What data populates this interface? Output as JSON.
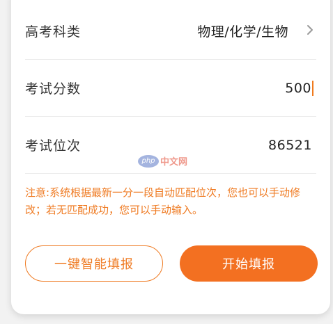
{
  "form": {
    "subjects": {
      "label": "高考科类",
      "value": "物理/化学/生物"
    },
    "score": {
      "label": "考试分数",
      "value": "500"
    },
    "rank": {
      "label": "考试位次",
      "value": "86521"
    }
  },
  "notice": "注意:系统根据最新一分一段自动匹配位次，您也可以手动修改；若无匹配成功，您可以手动输入。",
  "buttons": {
    "one_click": "一键智能填报",
    "start": "开始填报"
  },
  "watermark": {
    "badge": "php",
    "text": "中文网"
  },
  "colors": {
    "accent": "#f37021",
    "notice": "#ef7b23"
  }
}
